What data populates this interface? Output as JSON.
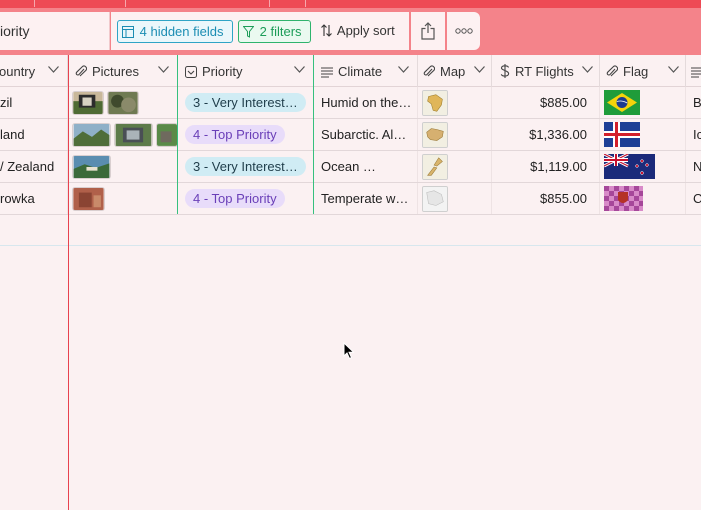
{
  "toolbar": {
    "view_name": "iority",
    "hidden_fields": "4 hidden fields",
    "filters": "2 filters",
    "apply_sort": "Apply sort"
  },
  "columns": [
    {
      "label": "ountry",
      "icon": "long-text-icon"
    },
    {
      "label": "Pictures",
      "icon": "attachment-icon"
    },
    {
      "label": "Priority",
      "icon": "single-select-icon"
    },
    {
      "label": "Climate",
      "icon": "long-text-icon"
    },
    {
      "label": "Map",
      "icon": "attachment-icon"
    },
    {
      "label": "RT Flights",
      "icon": "currency-icon"
    },
    {
      "label": "Flag",
      "icon": "attachment-icon"
    }
  ],
  "rows": [
    {
      "country": "zil",
      "priority": "3 - Very Interest…",
      "climate": "Humid on the…",
      "flights": "$885.00",
      "extra": "B"
    },
    {
      "country": "land",
      "priority": "4 - Top Priority",
      "climate": "Subarctic. Al…",
      "flights": "$1,336.00",
      "extra": "Ic"
    },
    {
      "country": "/ Zealand",
      "priority": "3 - Very Interest…",
      "climate": "Ocean …",
      "flights": "$1,119.00",
      "extra": "N"
    },
    {
      "country": "rowka",
      "priority": "4 - Top Priority",
      "climate": "Temperate w…",
      "flights": "$855.00",
      "extra": "C"
    }
  ],
  "colors": {
    "brand_red": "#ee4a55",
    "priority3_bg": "#d0ecf4",
    "priority4_bg": "#e8dcfa",
    "priority4_text": "#6a3fb8"
  }
}
